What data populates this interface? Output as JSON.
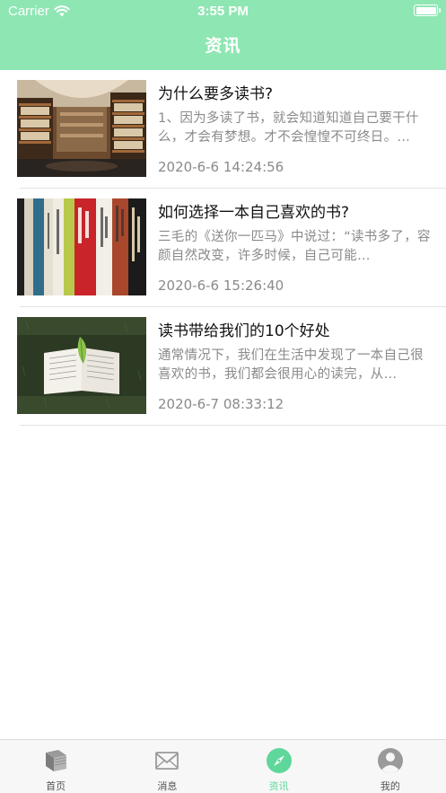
{
  "status_bar": {
    "carrier": "Carrier",
    "time": "3:55 PM"
  },
  "nav": {
    "title": "资讯"
  },
  "articles": [
    {
      "title": "为什么要多读书?",
      "summary": "1、因为多读了书，就会知道知道自己要干什么，才会有梦想。才不会惶惶不可终日。…",
      "date": "2020-6-6 14:24:56",
      "image": "library-interior-photo"
    },
    {
      "title": "如何选择一本自己喜欢的书?",
      "summary": "三毛的《送你一匹马》中说过：“读书多了，容颜自然改变，许多时候，自己可能…",
      "date": "2020-6-6 15:26:40",
      "image": "book-spines-photo"
    },
    {
      "title": "读书带给我们的10个好处",
      "summary": "通常情况下，我们在生活中发现了一本自己很喜欢的书，我们都会很用心的读完，从…",
      "date": "2020-6-7 08:33:12",
      "image": "open-book-on-grass-photo"
    }
  ],
  "tabbar": {
    "tabs": [
      {
        "label": "首页",
        "icon": "book-icon",
        "active": false
      },
      {
        "label": "消息",
        "icon": "envelope-icon",
        "active": false
      },
      {
        "label": "资讯",
        "icon": "compass-icon",
        "active": true
      },
      {
        "label": "我的",
        "icon": "person-icon",
        "active": false
      }
    ]
  },
  "colors": {
    "accent": "#8ee6b3",
    "active_tab": "#5fd69a",
    "muted_text": "#8a8a8a"
  }
}
